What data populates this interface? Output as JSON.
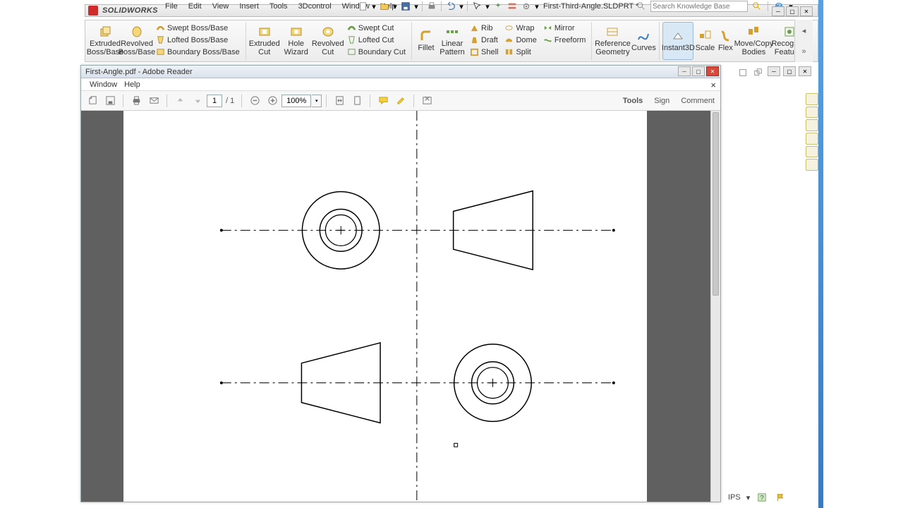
{
  "sw": {
    "brand": "SOLIDWORKS",
    "menus": [
      "File",
      "Edit",
      "View",
      "Insert",
      "Tools",
      "3Dcontrol",
      "Window",
      "Help"
    ],
    "doc_title": "First-Third-Angle.SLDPRT *",
    "search_placeholder": "Search Knowledge Base"
  },
  "ribbon": {
    "extruded_boss": "Extruded Boss/Base",
    "revolved_boss": "Revolved Boss/Base",
    "swept_boss": "Swept Boss/Base",
    "lofted_boss": "Lofted Boss/Base",
    "boundary_boss": "Boundary Boss/Base",
    "extruded_cut": "Extruded Cut",
    "hole_wizard": "Hole Wizard",
    "revolved_cut": "Revolved Cut",
    "swept_cut": "Swept Cut",
    "lofted_cut": "Lofted Cut",
    "boundary_cut": "Boundary Cut",
    "fillet": "Fillet",
    "linear_pattern": "Linear Pattern",
    "rib": "Rib",
    "draft": "Draft",
    "shell": "Shell",
    "wrap": "Wrap",
    "dome": "Dome",
    "split": "Split",
    "mirror": "Mirror",
    "freeform": "Freeform",
    "ref_geom": "Reference Geometry",
    "curves": "Curves",
    "instant3d": "Instant3D",
    "scale": "Scale",
    "flex": "Flex",
    "movecopy": "Move/Copy Bodies",
    "recognize": "Recognize Features"
  },
  "pdf": {
    "title": "First-Angle.pdf - Adobe Reader",
    "menu_window": "Window",
    "menu_help": "Help",
    "page": "1",
    "pages": "/ 1",
    "zoom": "100%",
    "tools": "Tools",
    "sign": "Sign",
    "comment": "Comment"
  },
  "status": {
    "units": "IPS"
  }
}
